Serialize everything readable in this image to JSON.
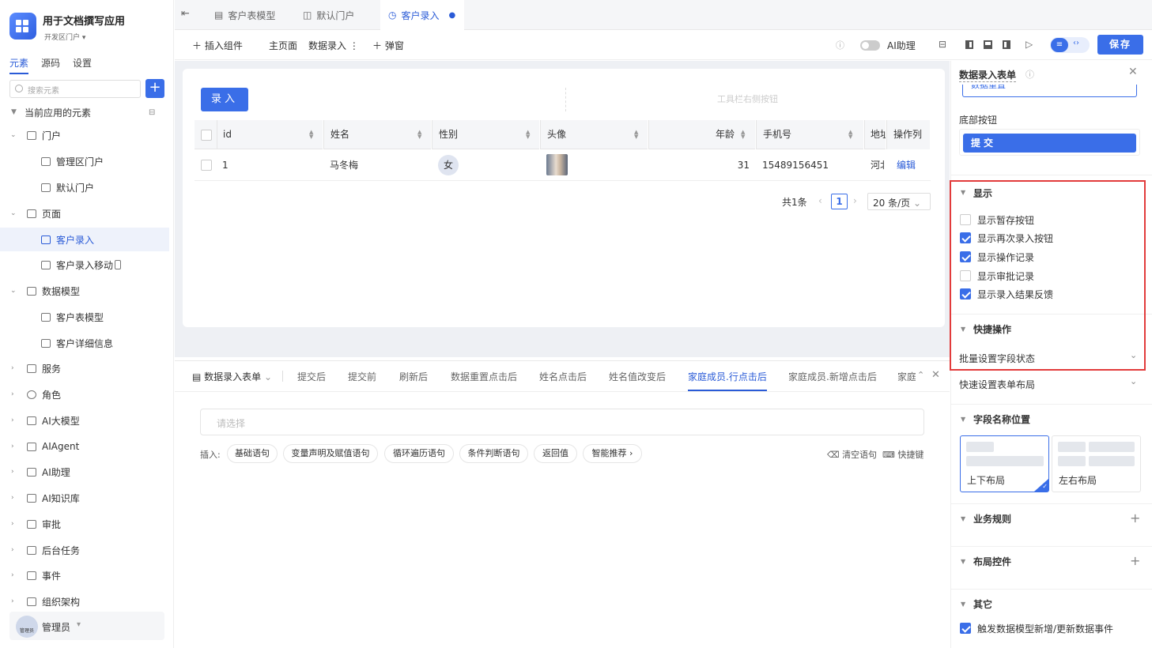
{
  "app": {
    "title": "用于文档撰写应用",
    "env": "开发区门户"
  },
  "sidebar": {
    "tabs": [
      "元素",
      "源码",
      "设置"
    ],
    "search_placeholder": "搜索元素",
    "section_label": "当前应用的元素",
    "items": [
      {
        "label": "门户"
      },
      {
        "label": "管理区门户"
      },
      {
        "label": "默认门户"
      },
      {
        "label": "页面"
      },
      {
        "label": "客户录入"
      },
      {
        "label": "客户录入移动"
      },
      {
        "label": "数据模型"
      },
      {
        "label": "客户表模型"
      },
      {
        "label": "客户详细信息"
      },
      {
        "label": "服务"
      },
      {
        "label": "角色"
      },
      {
        "label": "AI大模型"
      },
      {
        "label": "AIAgent"
      },
      {
        "label": "AI助理"
      },
      {
        "label": "AI知识库"
      },
      {
        "label": "审批"
      },
      {
        "label": "后台任务"
      },
      {
        "label": "事件"
      },
      {
        "label": "组织架构"
      }
    ],
    "user": {
      "name": "管理员",
      "avatar_text": "管理员"
    }
  },
  "tabs": [
    {
      "label": "客户表模型"
    },
    {
      "label": "默认门户"
    },
    {
      "label": "客户录入"
    }
  ],
  "toolbar": {
    "insert": "插入组件",
    "main_page": "主页面",
    "data_entry": "数据录入",
    "popup": "弹窗",
    "ai_assistant": "AI助理",
    "save": "保存"
  },
  "canvas": {
    "entry_button": "录入",
    "toolbar_right": "工具栏右侧按钮",
    "columns": [
      "id",
      "姓名",
      "性别",
      "头像",
      "年龄",
      "手机号",
      "地址",
      "操作列"
    ],
    "rows": [
      {
        "id": "1",
        "name": "马冬梅",
        "gender": "女",
        "age": "31",
        "phone": "15489156451",
        "address": "河北",
        "action": "编辑"
      }
    ],
    "pagination": {
      "total": "共1条",
      "page": "1",
      "page_size": "20 条/页"
    }
  },
  "events": {
    "tabs": [
      "数据录入表单",
      "提交后",
      "提交前",
      "刷新后",
      "数据重置点击后",
      "姓名点击后",
      "姓名值改变后",
      "家庭成员.行点击后",
      "家庭成员.新增点击后",
      "家庭"
    ],
    "placeholder": "请选择",
    "insert_label": "插入:",
    "chips": [
      "基础语句",
      "变量声明及赋值语句",
      "循环遍历语句",
      "条件判断语句",
      "返回值",
      "智能推荐 ›"
    ],
    "clear": "清空语句",
    "shortcut": "快捷键"
  },
  "panel": {
    "title": "数据录入表单",
    "partial_button": "数据重置",
    "bottom_button_label": "底部按钮",
    "submit": "提交",
    "display_header": "显示",
    "display_options": [
      {
        "label": "显示暂存按钮",
        "checked": false
      },
      {
        "label": "显示再次录入按钮",
        "checked": true
      },
      {
        "label": "显示操作记录",
        "checked": true
      },
      {
        "label": "显示审批记录",
        "checked": false
      },
      {
        "label": "显示录入结果反馈",
        "checked": true
      }
    ],
    "quick_header": "快捷操作",
    "batch_field": "批量设置字段状态",
    "quick_layout": "快速设置表单布局",
    "field_pos_header": "字段名称位置",
    "layout_top": "上下布局",
    "layout_left": "左右布局",
    "rules_header": "业务规则",
    "layout_ctrl_header": "布局控件",
    "other_header": "其它",
    "trigger": "触发数据模型新增/更新数据事件"
  }
}
